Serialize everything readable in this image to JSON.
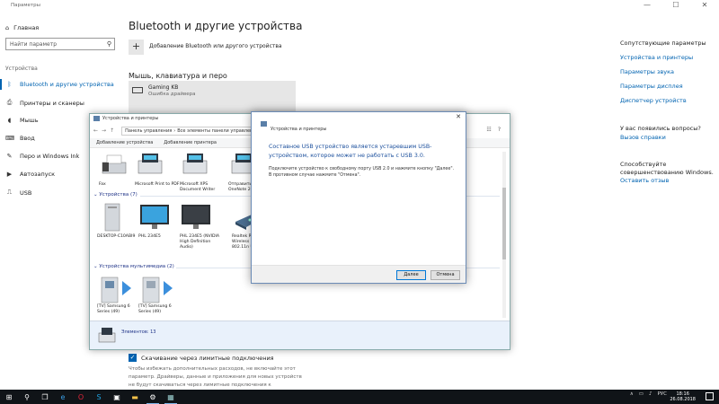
{
  "window": {
    "title": "Параметры",
    "controls": [
      "—",
      "☐",
      "✕"
    ]
  },
  "nav": {
    "home": "Главная",
    "search_placeholder": "Найти параметр",
    "section": "Устройства",
    "items": [
      {
        "label": "Bluetooth и другие устройства",
        "icon": "bluetooth-icon",
        "active": true
      },
      {
        "label": "Принтеры и сканеры",
        "icon": "printer-icon"
      },
      {
        "label": "Мышь",
        "icon": "mouse-icon"
      },
      {
        "label": "Ввод",
        "icon": "keyboard-icon"
      },
      {
        "label": "Перо и Windows Ink",
        "icon": "pen-icon"
      },
      {
        "label": "Автозапуск",
        "icon": "autoplay-icon"
      },
      {
        "label": "USB",
        "icon": "usb-icon"
      }
    ]
  },
  "main": {
    "title": "Bluetooth и другие устройства",
    "add_label": "Добавление Bluetooth или другого устройства",
    "section": "Мышь, клавиатура и перо",
    "device": {
      "name": "Gaming KB",
      "status": "Ошибка драйвера"
    },
    "metered_label": "Скачивание через лимитные подключения",
    "metered_desc": "Чтобы избежать дополнительных расходов, не включайте этот параметр. Драйверы, данные и приложения для новых устройств не будут скачиваться через лимитные подключения к"
  },
  "right": {
    "related_head": "Сопутствующие параметры",
    "related": [
      "Устройства и принтеры",
      "Параметры звука",
      "Параметры дисплея",
      "Диспетчер устройств"
    ],
    "question_head": "У вас появились вопросы?",
    "help": "Вызов справки",
    "improve_head": "Способствуйте совершенствованию Windows.",
    "feedback": "Оставить отзыв"
  },
  "explorer": {
    "title": "Устройства и принтеры",
    "breadcrumb": [
      "Панель управления",
      "Все элементы панели управления",
      "Устройства и принтеры"
    ],
    "commands": [
      "Добавление устройства",
      "Добавление принтера"
    ],
    "printers": [
      "Fax",
      "Microsoft Print to PDF",
      "Microsoft XPS Document Writer",
      "Отправить в OneNote 2010"
    ],
    "devices_head": "Устройства (7)",
    "devices": [
      "DESKTOP-C10ABI9",
      "PHL 234E5",
      "PHL 234E5 (NVIDIA High Definition Audio)",
      "Realtek RTL8192CU Wireless LAN 802.11n USB 2..."
    ],
    "multimedia_head": "Устройства мультимедиа (2)",
    "multimedia": [
      "[TV] Samsung 6 Series (49)",
      "[TV] Samsung 6 Series (49)"
    ],
    "status": "Элементов: 13"
  },
  "dialog": {
    "title": "Устройства и принтеры",
    "main": "Составное USB устройство является устаревшим USB-устройством, которое может не работать с USB 3.0.",
    "sub": "Подключите устройство к свободному порту USB 2.0 и нажмите кнопку \"Далее\". В противном случае нажмите \"Отмена\".",
    "next": "Далее",
    "cancel": "Отмена"
  },
  "taskbar": {
    "items": [
      "windows-start-icon",
      "search-icon",
      "task-view-icon",
      "edge-icon",
      "opera-icon",
      "skype-icon",
      "store-icon",
      "explorer-icon",
      "settings-icon",
      "devices-window-icon"
    ],
    "lang": "РУС",
    "time": "18:16",
    "date": "26.08.2018"
  },
  "colors": {
    "accent": "#0063b1",
    "link": "#0063b1",
    "dialog_text": "#1b4f9c",
    "taskbar": "#101418"
  }
}
